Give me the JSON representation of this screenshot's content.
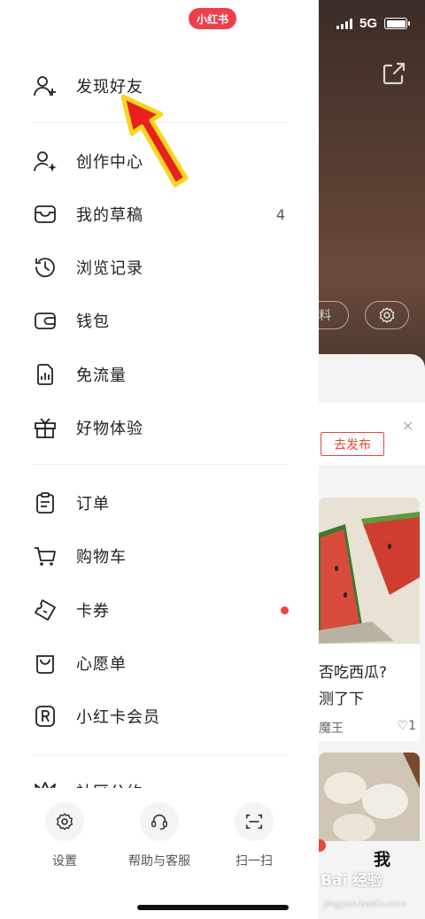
{
  "app": {
    "logo": "小红书"
  },
  "status_bar": {
    "network": "5G"
  },
  "background": {
    "pill_left_text": "料",
    "publish_label": "去发布",
    "close_glyph": "×",
    "card_caption_line1": "否吃西瓜?",
    "card_caption_line2": "测了下",
    "card_author": "魔王",
    "card_likes": "1",
    "tab_me": "我",
    "badge": "",
    "watermark": "Bai 经验",
    "watermark_url": "jingyan.baidu.com"
  },
  "menu": {
    "items": [
      {
        "label": "发现好友",
        "icon": "add-friend-icon"
      },
      {
        "label": "创作中心",
        "icon": "creator-icon"
      },
      {
        "label": "我的草稿",
        "icon": "drafts-icon",
        "count": "4"
      },
      {
        "label": "浏览记录",
        "icon": "history-icon"
      },
      {
        "label": "钱包",
        "icon": "wallet-icon"
      },
      {
        "label": "免流量",
        "icon": "data-free-icon"
      },
      {
        "label": "好物体验",
        "icon": "gift-icon"
      },
      {
        "label": "订单",
        "icon": "order-icon"
      },
      {
        "label": "购物车",
        "icon": "cart-icon"
      },
      {
        "label": "卡券",
        "icon": "coupon-icon"
      },
      {
        "label": "心愿单",
        "icon": "wishlist-icon"
      },
      {
        "label": "小红卡会员",
        "icon": "membership-icon"
      },
      {
        "label": "社区公约",
        "icon": "community-icon"
      }
    ]
  },
  "bottom": {
    "settings": "设置",
    "help": "帮助与客服",
    "scan": "扫一扫"
  },
  "colors": {
    "brand": "#ef3f4c",
    "arrow_fill": "#e8201e",
    "arrow_outline": "#f6d71e"
  }
}
